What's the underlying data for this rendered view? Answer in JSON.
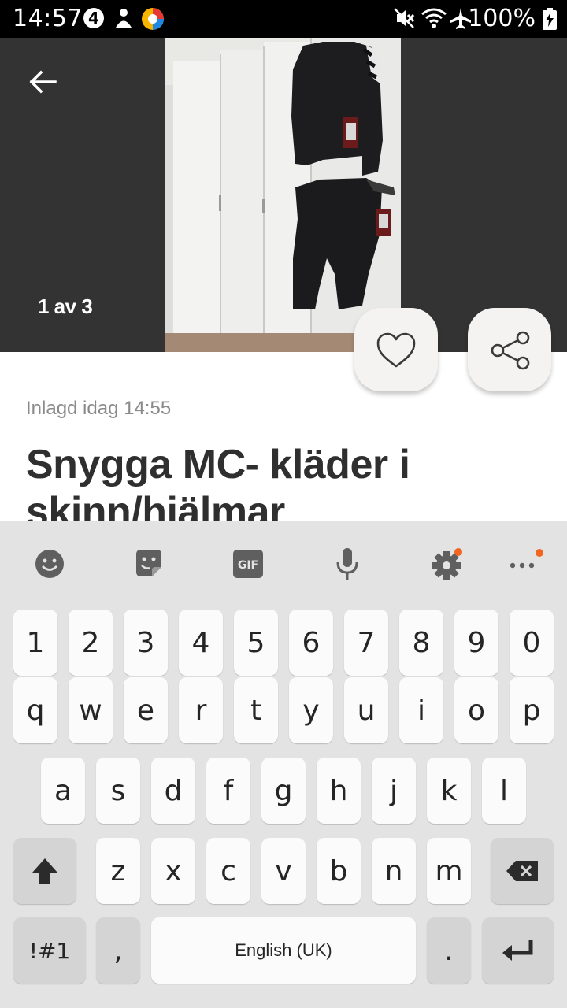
{
  "status_bar": {
    "time": "14:57",
    "battery": "100%",
    "icons": [
      "notification-4-icon",
      "person-icon",
      "app-icon",
      "mute-icon",
      "wifi-icon",
      "airplane-icon",
      "battery-charging-icon"
    ]
  },
  "gallery": {
    "counter": "1 av 3",
    "back_icon": "arrow-left-icon",
    "favorite_icon": "heart-icon",
    "share_icon": "share-icon"
  },
  "listing": {
    "posted": "Inlagd idag 14:55",
    "title": "Snygga MC- kläder i skinn/hjälmar"
  },
  "keyboard": {
    "toolbar": [
      "emoji-icon",
      "sticker-icon",
      "gif-icon",
      "mic-icon",
      "settings-icon",
      "more-icon"
    ],
    "gif_label": "GIF",
    "rows": {
      "numbers": [
        "1",
        "2",
        "3",
        "4",
        "5",
        "6",
        "7",
        "8",
        "9",
        "0"
      ],
      "row1": [
        "q",
        "w",
        "e",
        "r",
        "t",
        "y",
        "u",
        "i",
        "o",
        "p"
      ],
      "row2": [
        "a",
        "s",
        "d",
        "f",
        "g",
        "h",
        "j",
        "k",
        "l"
      ],
      "row3": [
        "z",
        "x",
        "c",
        "v",
        "b",
        "n",
        "m"
      ]
    },
    "symbols_label": "!#1",
    "comma_label": ",",
    "space_label": "English (UK)",
    "period_label": ".",
    "accent_color": "#f26522"
  }
}
